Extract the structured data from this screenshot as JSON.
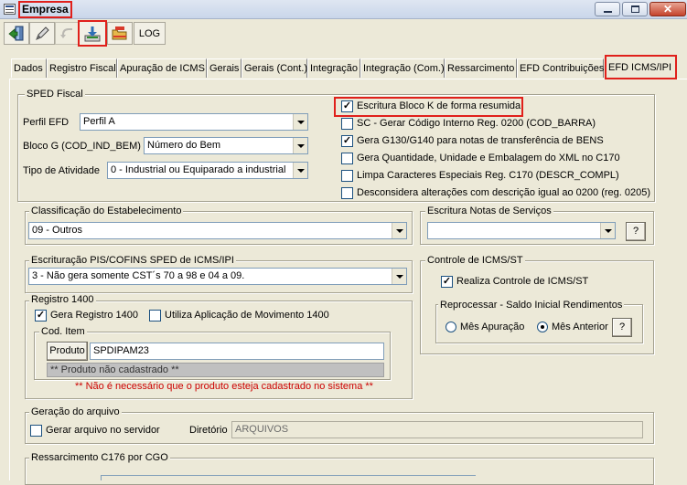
{
  "window": {
    "title": "Empresa",
    "controls": [
      "minimize-icon",
      "maximize-icon",
      "close-icon"
    ]
  },
  "toolbar": {
    "log_label": "LOG",
    "icons": [
      "exit-icon",
      "edit-icon",
      "undo-icon",
      "save-icon",
      "open-folder-icon"
    ]
  },
  "tabs": [
    {
      "label": "Dados"
    },
    {
      "label": "Registro Fiscal"
    },
    {
      "label": "Apuração de ICMS"
    },
    {
      "label": "Gerais"
    },
    {
      "label": "Gerais (Cont.)"
    },
    {
      "label": "Integração"
    },
    {
      "label": "Integração (Com.)"
    },
    {
      "label": "Ressarcimento"
    },
    {
      "label": "EFD Contribuições"
    },
    {
      "label": "EFD ICMS/IPI",
      "active": true
    }
  ],
  "sped": {
    "title": "SPED Fiscal",
    "perfil_label": "Perfil EFD",
    "perfil_value": "Perfil A",
    "blocog_label": "Bloco G (COD_IND_BEM)",
    "blocog_value": "Número do Bem",
    "tipo_label": "Tipo de Atividade",
    "tipo_value": "0 - Industrial ou Equiparado a industrial",
    "checks": [
      {
        "label": "Escritura Bloco K de forma resumida",
        "checked": true
      },
      {
        "label": "SC - Gerar Código Interno Reg. 0200 (COD_BARRA)",
        "checked": false
      },
      {
        "label": "Gera G130/G140 para notas de transferência de BENS",
        "checked": true
      },
      {
        "label": "Gera Quantidade, Unidade e Embalagem do XML no C170",
        "checked": false
      },
      {
        "label": "Limpa Caracteres Especiais Reg. C170 (DESCR_COMPL)",
        "checked": false
      },
      {
        "label": "Desconsidera alterações com descrição igual ao 0200 (reg. 0205)",
        "checked": false
      }
    ]
  },
  "classificacao": {
    "title": "Classificação do Estabelecimento",
    "value": "09 - Outros"
  },
  "notas_servicos": {
    "title": "Escritura Notas de Serviços",
    "value": "",
    "help": "?"
  },
  "piscofins": {
    "title": "Escrituração PIS/COFINS SPED de ICMS/IPI",
    "value": "3 - Não gera somente CST´s 70 a 98 e 04 a 09."
  },
  "controle_st": {
    "title": "Controle de ICMS/ST",
    "realiza_label": "Realiza Controle de ICMS/ST",
    "realiza_checked": true,
    "reprocessar_title": "Reprocessar - Saldo Inicial Rendimentos",
    "radio_1": "Mês Apuração",
    "radio_2": "Mês Anterior",
    "radio_selected": "Mês Anterior",
    "help": "?"
  },
  "registro1400": {
    "title": "Registro 1400",
    "gera_label": "Gera Registro 1400",
    "gera_checked": true,
    "utiliza_label": "Utiliza Aplicação de Movimento 1400",
    "utiliza_checked": false,
    "cod_item_title": "Cod. Item",
    "produto_button": "Produto",
    "produto_value": "SPDIPAM23",
    "produto_status": "** Produto não cadastrado **",
    "warning": "** Não é necessário que o produto esteja cadastrado no sistema **",
    "warning_color": "#cc0000"
  },
  "geracao": {
    "title": "Geração do arquivo",
    "gerar_label": "Gerar arquivo no servidor",
    "gerar_checked": false,
    "diretorio_label": "Diretório",
    "diretorio_value": "ARQUIVOS"
  },
  "ressarcimento": {
    "title": "Ressarcimento C176 por CGO"
  },
  "colors": {
    "highlight_red": "#e0201b",
    "background": "#ece9d8"
  }
}
